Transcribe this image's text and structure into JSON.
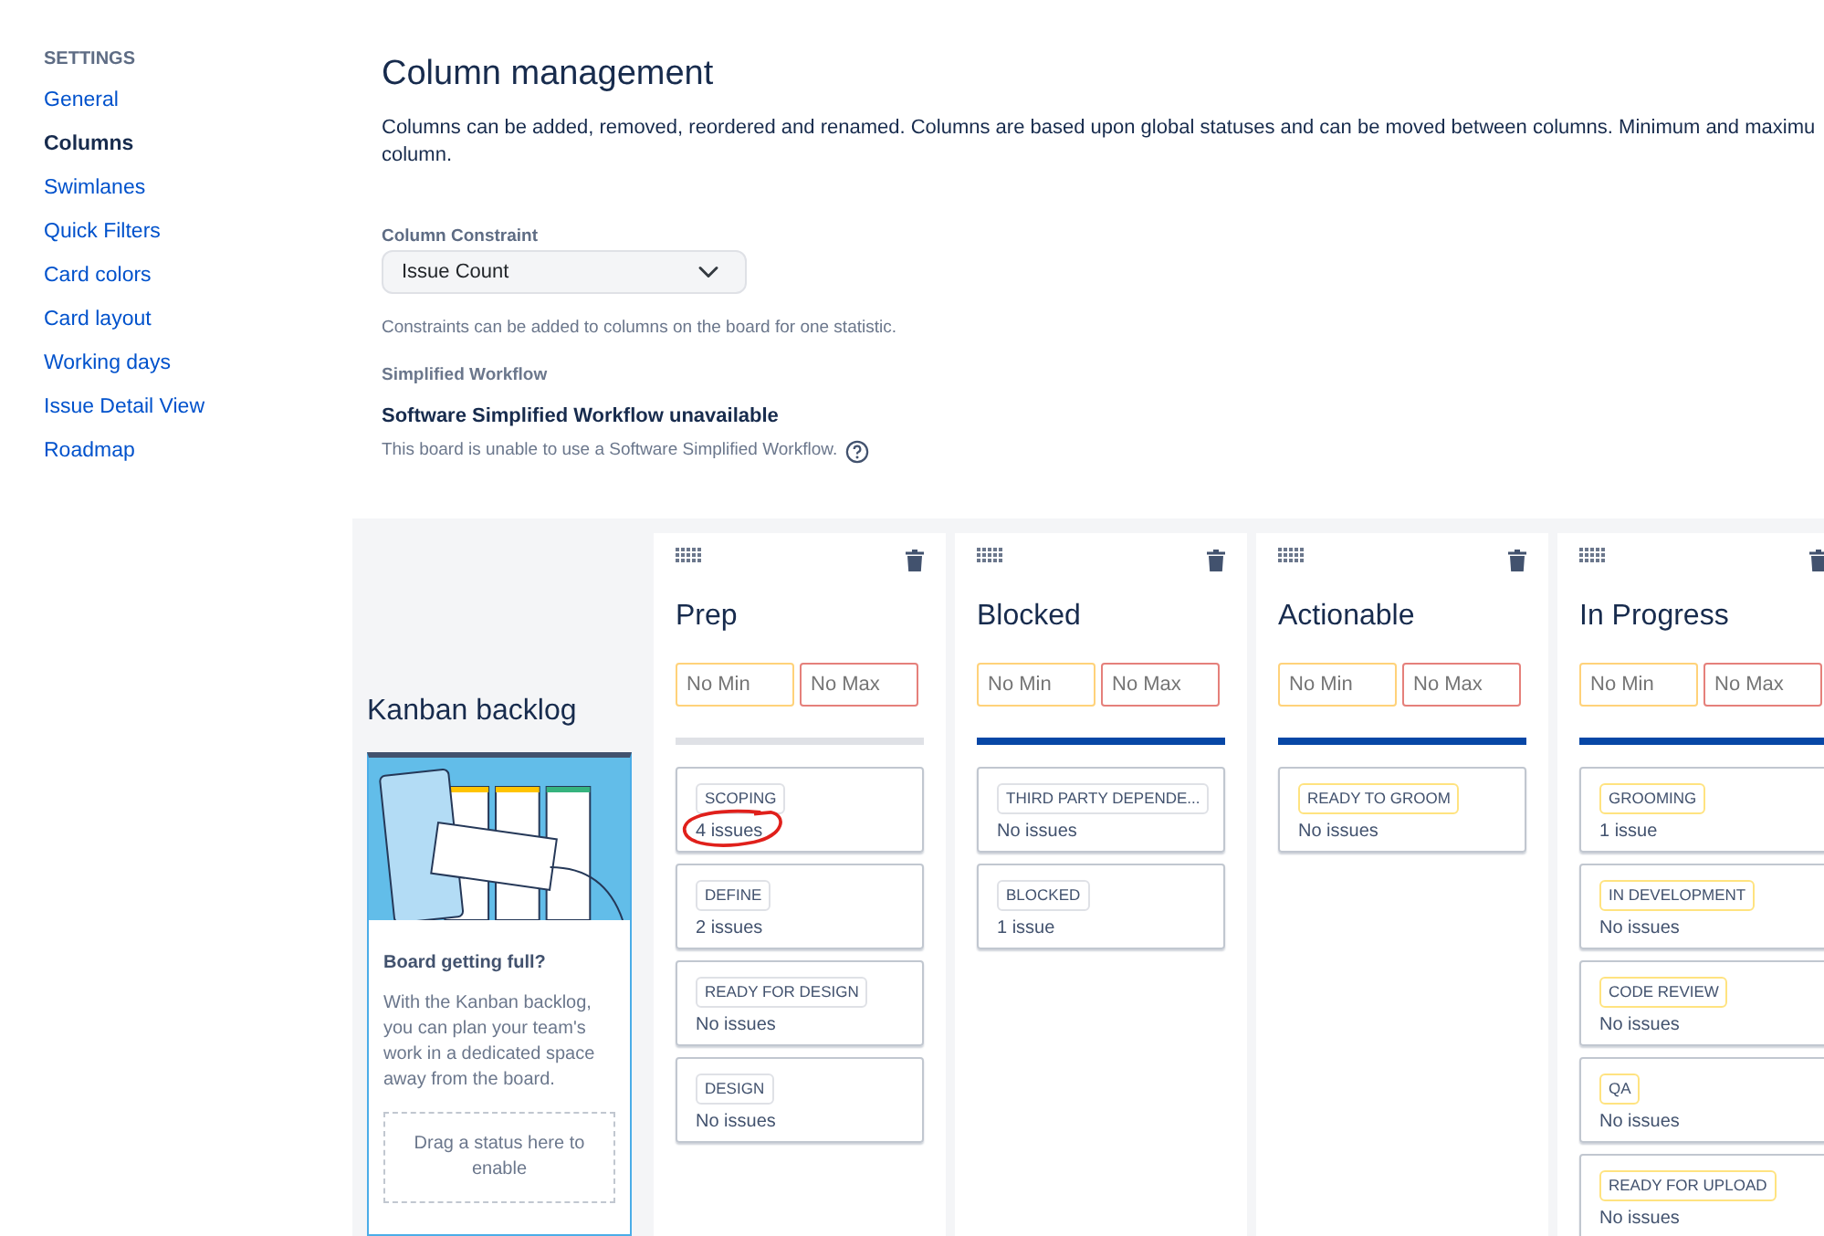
{
  "sidebar": {
    "heading": "SETTINGS",
    "items": [
      {
        "label": "General",
        "selected": false
      },
      {
        "label": "Columns",
        "selected": true
      },
      {
        "label": "Swimlanes",
        "selected": false
      },
      {
        "label": "Quick Filters",
        "selected": false
      },
      {
        "label": "Card colors",
        "selected": false
      },
      {
        "label": "Card layout",
        "selected": false
      },
      {
        "label": "Working days",
        "selected": false
      },
      {
        "label": "Issue Detail View",
        "selected": false
      },
      {
        "label": "Roadmap",
        "selected": false
      }
    ]
  },
  "page": {
    "title": "Column management",
    "description_lines": [
      "Columns can be added, removed, reordered and renamed. Columns are based upon global statuses and can be moved between columns. Minimum and maximu",
      "column."
    ],
    "constraint": {
      "label": "Column Constraint",
      "value": "Issue Count",
      "help": "Constraints can be added to columns on the board for one statistic."
    },
    "workflow": {
      "label": "Simplified Workflow",
      "heading": "Software Simplified Workflow unavailable",
      "help": "This board is unable to use a Software Simplified Workflow."
    }
  },
  "backlog": {
    "title": "Kanban backlog",
    "card_heading": "Board getting full?",
    "card_text": "With the Kanban backlog, you can plan your team's work in a dedicated space away from the board.",
    "drop_hint": "Drag a status here to enable"
  },
  "columns": [
    {
      "name": "Prep",
      "min_placeholder": "No Min",
      "max_placeholder": "No Max",
      "color": "#dfe1e6",
      "statuses": [
        {
          "name": "SCOPING",
          "count": "4 issues",
          "color": "#dfe1e6",
          "circled": true
        },
        {
          "name": "DEFINE",
          "count": "2 issues",
          "color": "#dfe1e6",
          "circled": false
        },
        {
          "name": "READY FOR DESIGN",
          "count": "No issues",
          "color": "#dfe1e6",
          "circled": false
        },
        {
          "name": "DESIGN",
          "count": "No issues",
          "color": "#dfe1e6",
          "circled": false
        }
      ]
    },
    {
      "name": "Blocked",
      "min_placeholder": "No Min",
      "max_placeholder": "No Max",
      "color": "#0747a6",
      "statuses": [
        {
          "name": "THIRD PARTY DEPENDE...",
          "count": "No issues",
          "color": "#dfe1e6",
          "circled": false
        },
        {
          "name": "BLOCKED",
          "count": "1 issue",
          "color": "#dfe1e6",
          "circled": false
        }
      ]
    },
    {
      "name": "Actionable",
      "min_placeholder": "No Min",
      "max_placeholder": "No Max",
      "color": "#0747a6",
      "statuses": [
        {
          "name": "READY TO GROOM",
          "count": "No issues",
          "color": "#ffe380",
          "circled": false
        }
      ]
    },
    {
      "name": "In Progress",
      "min_placeholder": "No Min",
      "max_placeholder": "No Max",
      "color": "#0747a6",
      "statuses": [
        {
          "name": "GROOMING",
          "count": "1 issue",
          "color": "#ffe380",
          "circled": false
        },
        {
          "name": "IN DEVELOPMENT",
          "count": "No issues",
          "color": "#ffe380",
          "circled": false
        },
        {
          "name": "CODE REVIEW",
          "count": "No issues",
          "color": "#ffe380",
          "circled": false
        },
        {
          "name": "QA",
          "count": "No issues",
          "color": "#ffe380",
          "circled": false
        },
        {
          "name": "READY FOR UPLOAD",
          "count": "No issues",
          "color": "#ffe380",
          "circled": false
        }
      ]
    }
  ]
}
